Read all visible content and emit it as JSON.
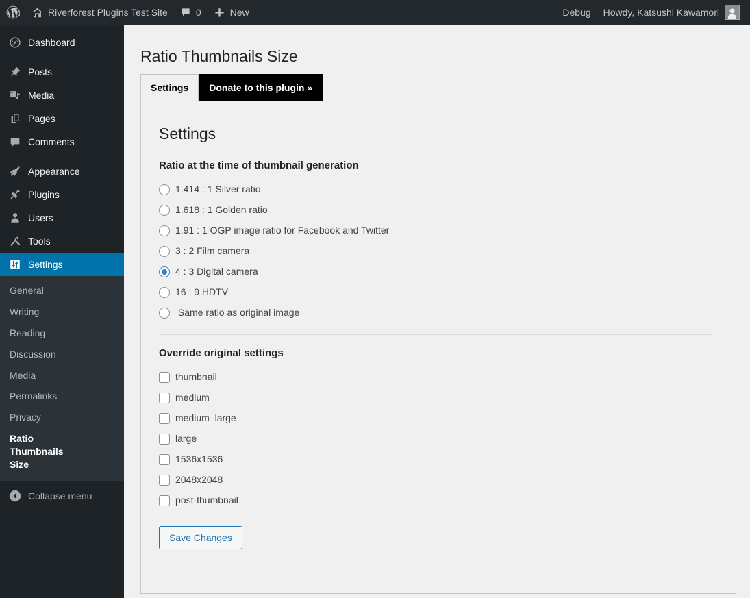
{
  "adminbar": {
    "wp_logo_icon": "wordpress-logo-icon",
    "site_icon": "home-icon",
    "site_name": "Riverforest Plugins Test Site",
    "comments_icon": "comment-bubble-icon",
    "comments_count": "0",
    "new_icon": "plus-icon",
    "new_label": "New",
    "debug_label": "Debug",
    "howdy_label": "Howdy, Katsushi Kawamori",
    "avatar_icon": "user-avatar-icon"
  },
  "sidebar": {
    "items": [
      {
        "label": "Dashboard",
        "icon": "dashboard-gauge-icon",
        "current": false
      },
      {
        "label": "Posts",
        "icon": "pushpin-icon",
        "current": false
      },
      {
        "label": "Media",
        "icon": "media-icon",
        "current": false
      },
      {
        "label": "Pages",
        "icon": "pages-icon",
        "current": false
      },
      {
        "label": "Comments",
        "icon": "comment-bubble-icon",
        "current": false
      },
      {
        "label": "Appearance",
        "icon": "paintbrush-icon",
        "current": false
      },
      {
        "label": "Plugins",
        "icon": "plug-icon",
        "current": false
      },
      {
        "label": "Users",
        "icon": "user-icon",
        "current": false
      },
      {
        "label": "Tools",
        "icon": "wrench-icon",
        "current": false
      },
      {
        "label": "Settings",
        "icon": "sliders-icon",
        "current": true
      }
    ],
    "submenu": [
      {
        "label": "General",
        "current": false
      },
      {
        "label": "Writing",
        "current": false
      },
      {
        "label": "Reading",
        "current": false
      },
      {
        "label": "Discussion",
        "current": false
      },
      {
        "label": "Media",
        "current": false
      },
      {
        "label": "Permalinks",
        "current": false
      },
      {
        "label": "Privacy",
        "current": false
      },
      {
        "label": "Ratio Thumbnails Size",
        "current": true
      }
    ],
    "collapse": {
      "label": "Collapse menu",
      "icon": "chevron-left-circle-icon"
    }
  },
  "page": {
    "title": "Ratio Thumbnails Size",
    "tabs": [
      {
        "label": "Settings",
        "style": "active"
      },
      {
        "label": "Donate to this plugin »",
        "style": "donate"
      }
    ],
    "settings_heading": "Settings",
    "ratio_section_title": "Ratio at the time of thumbnail generation",
    "ratio_options": [
      {
        "label": "1.414 : 1 Silver ratio",
        "checked": false
      },
      {
        "label": "1.618 : 1 Golden ratio",
        "checked": false
      },
      {
        "label": "1.91 : 1 OGP image ratio for Facebook and Twitter",
        "checked": false
      },
      {
        "label": "3 : 2 Film camera",
        "checked": false
      },
      {
        "label": "4 : 3 Digital camera",
        "checked": true
      },
      {
        "label": "16 : 9 HDTV",
        "checked": false
      },
      {
        "label": " Same ratio as original image",
        "checked": false
      }
    ],
    "override_section_title": "Override original settings",
    "override_options": [
      {
        "label": "thumbnail",
        "checked": false
      },
      {
        "label": "medium",
        "checked": false
      },
      {
        "label": "medium_large",
        "checked": false
      },
      {
        "label": "large",
        "checked": false
      },
      {
        "label": "1536x1536",
        "checked": false
      },
      {
        "label": "2048x2048",
        "checked": false
      },
      {
        "label": "post-thumbnail",
        "checked": false
      }
    ],
    "save_label": "Save Changes"
  },
  "colors": {
    "accent": "#2271b1",
    "radio_checked": "#3582c4",
    "sidebar_bg": "#1d2327",
    "submenu_bg": "#2c3338",
    "current_menu_bg": "#0073aa",
    "adminbar_bg": "#23282d",
    "content_bg": "#f0f0f1"
  }
}
